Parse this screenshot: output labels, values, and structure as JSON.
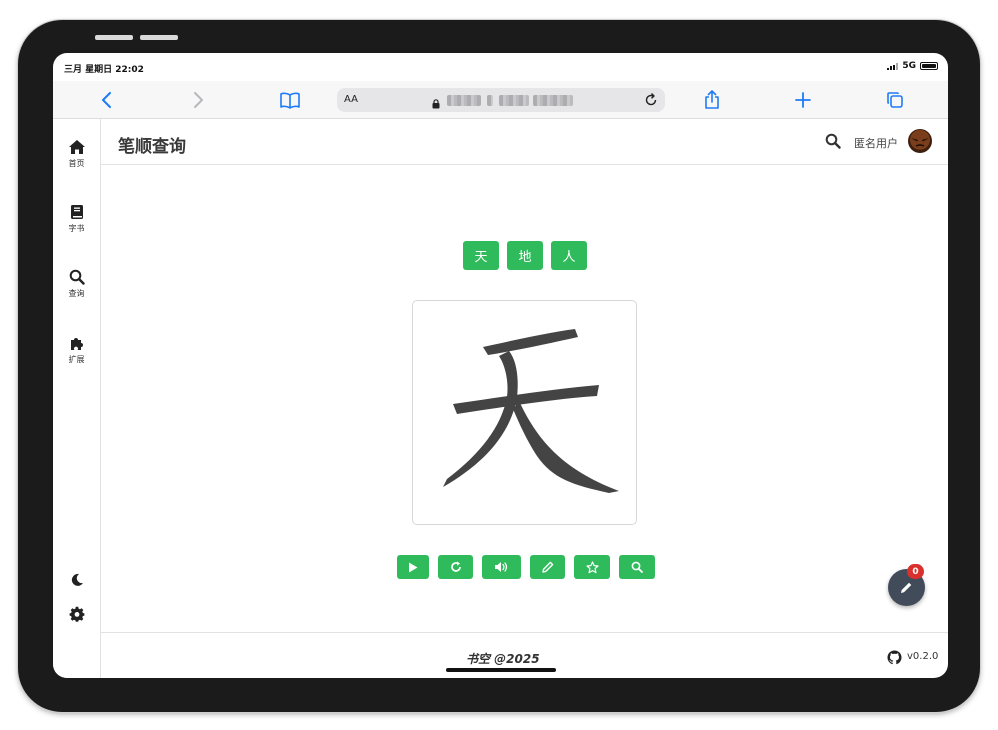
{
  "status_bar": {
    "time": "三月 星期日 22:02",
    "network": "5G"
  },
  "browser": {
    "address_aa": "AA",
    "icons": [
      "back-icon",
      "forward-icon",
      "bookmarks-icon",
      "lock-icon",
      "reload-icon",
      "share-icon",
      "new-tab-icon",
      "tabs-icon"
    ]
  },
  "sidebar": {
    "items": [
      {
        "label": "首页",
        "icon": "home-icon"
      },
      {
        "label": "字书",
        "icon": "book-icon"
      },
      {
        "label": "查询",
        "icon": "search-icon"
      },
      {
        "label": "扩展",
        "icon": "puzzle-icon"
      }
    ],
    "bottom_icons": [
      "moon-icon",
      "gear-icon"
    ]
  },
  "header": {
    "title": "笔顺查询",
    "username": "匿名用户"
  },
  "characters": [
    "天",
    "地",
    "人"
  ],
  "display_character": "天",
  "actions": [
    "play-icon",
    "redo-icon",
    "volume-icon",
    "pencil-icon",
    "star-icon",
    "search-icon"
  ],
  "fab": {
    "badge": "0"
  },
  "footer": {
    "copyright": "书空 @2025",
    "version": "v0.2.0"
  },
  "colors": {
    "accent": "#2fbb5b",
    "ios_blue": "#1f7bf5",
    "badge": "#d9312d",
    "fab": "#424b5a"
  }
}
